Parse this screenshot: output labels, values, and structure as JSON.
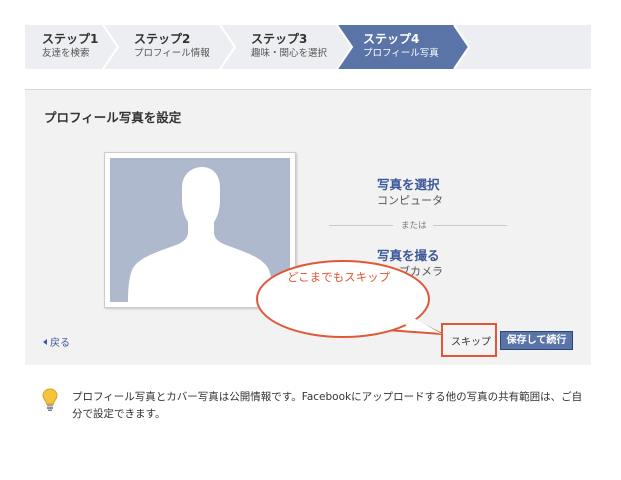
{
  "steps": [
    {
      "num": "ステップ1",
      "label": "友達を検索",
      "active": false
    },
    {
      "num": "ステップ2",
      "label": "プロフィール情報",
      "active": false
    },
    {
      "num": "ステップ3",
      "label": "趣味・関心を選択",
      "active": false
    },
    {
      "num": "ステップ4",
      "label": "プロフィール写真",
      "active": true
    }
  ],
  "panel": {
    "title": "プロフィール写真を設定",
    "upload": {
      "link": "写真を選択",
      "sub": "コンピュータ"
    },
    "or_text": "または",
    "take": {
      "link": "写真を撮る",
      "sub": "ウェブカメラ"
    },
    "back": "戻る",
    "skip": "スキップ",
    "save": "保存して続行"
  },
  "annotation": {
    "text": "どこまでもスキップ",
    "color": "#e0573a"
  },
  "info": {
    "text": "プロフィール写真とカバー写真は公開情報です。Facebookにアップロードする他の写真の共有範囲は、ご自分で設定できます。"
  },
  "colors": {
    "brand": "#3b5998",
    "active_step": "#5b74a8",
    "button": "#5b74a8",
    "avatar_bg": "#aeb9ce",
    "annotation": "#e0573a"
  },
  "icons": {
    "back": "triangle-left-icon",
    "info": "lightbulb-icon"
  }
}
